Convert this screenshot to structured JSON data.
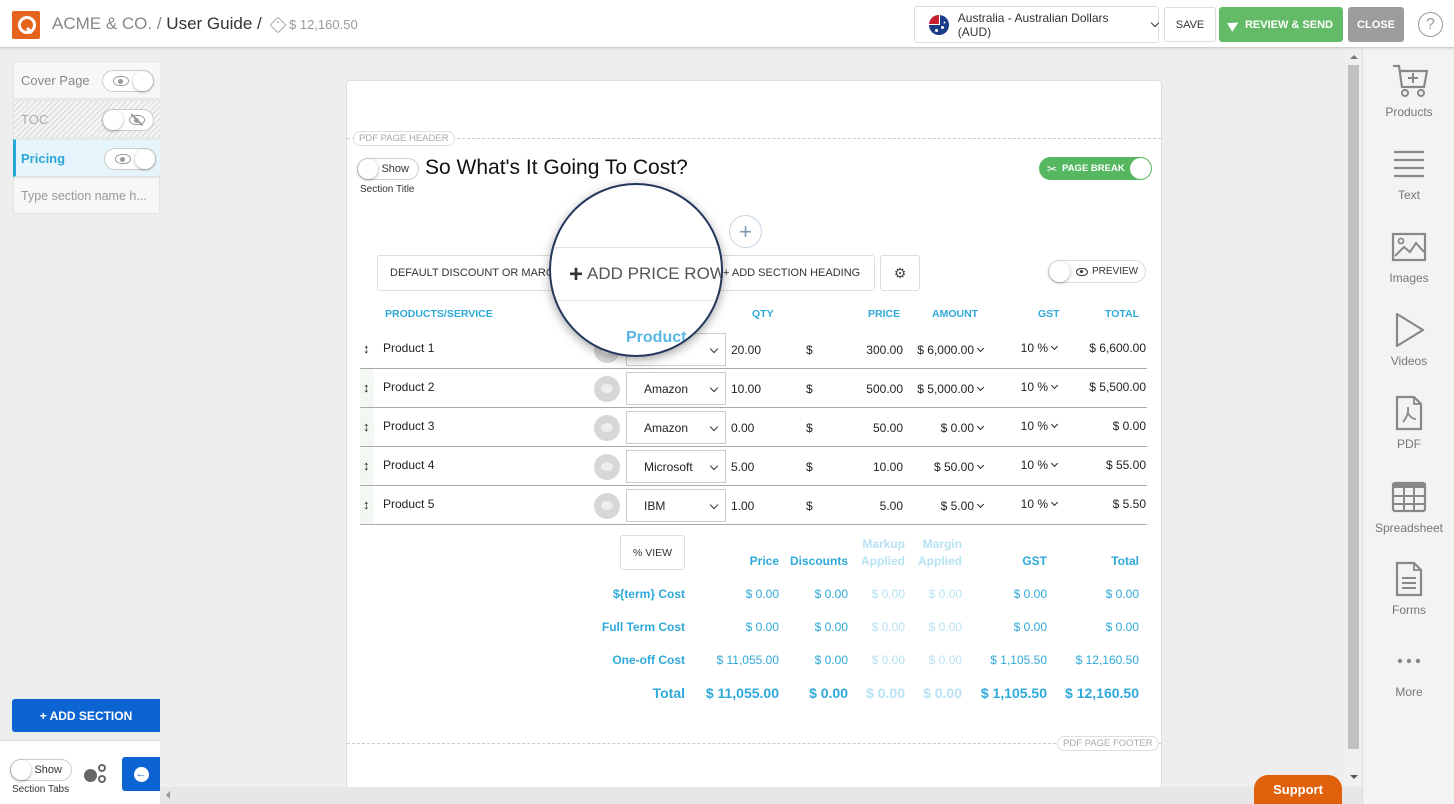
{
  "header": {
    "company": "ACME & CO. / ",
    "document": "User Guide /",
    "total": "$ 12,160.50",
    "currency": "Australia - Australian Dollars (AUD)",
    "save_label": "SAVE",
    "review_label": "REVIEW & SEND",
    "close_label": "CLOSE",
    "help_label": "?"
  },
  "sidebar": {
    "sections": [
      {
        "label": "Cover Page",
        "visible": true
      },
      {
        "label": "TOC",
        "visible": false
      },
      {
        "label": "Pricing",
        "visible": true,
        "active": true
      }
    ],
    "new_section_placeholder": "Type section name h...",
    "add_section_label": "+ ADD SECTION",
    "show_toggle_label": "Show",
    "section_tabs_caption": "Section Tabs"
  },
  "page": {
    "header_label": "PDF PAGE HEADER",
    "footer_label": "PDF PAGE FOOTER",
    "show_toggle_label": "Show",
    "section_title_caption": "Section Title",
    "title": "So What's It Going To Cost?",
    "page_break_label": "PAGE BREAK",
    "add_icon": "+",
    "toolbar": {
      "discount_label": "DEFAULT DISCOUNT OR MARGIN",
      "add_price_row_label": "ADD PRICE ROW",
      "add_section_heading_label": "+ ADD SECTION HEADING",
      "preview_label": "PREVIEW"
    },
    "magnifier": {
      "text": "ADD PRICE ROW",
      "plus": "+",
      "product_caption": "Product"
    },
    "columns": {
      "product": "PRODUCTS/SERVICE",
      "qty": "QTY",
      "price": "PRICE",
      "amount": "AMOUNT",
      "gst": "GST",
      "total": "TOTAL"
    },
    "rows": [
      {
        "name": "Product 1",
        "supplier": "",
        "qty": "20.00",
        "currency": "$",
        "price": "300.00",
        "amount": "$ 6,000.00",
        "gst": "10 %",
        "total": "$ 6,600.00"
      },
      {
        "name": "Product 2",
        "supplier": "Amazon",
        "qty": "10.00",
        "currency": "$",
        "price": "500.00",
        "amount": "$ 5,000.00",
        "gst": "10 %",
        "total": "$ 5,500.00"
      },
      {
        "name": "Product 3",
        "supplier": "Amazon",
        "qty": "0.00",
        "currency": "$",
        "price": "50.00",
        "amount": "$ 0.00",
        "gst": "10 %",
        "total": "$ 0.00"
      },
      {
        "name": "Product 4",
        "supplier": "Microsoft",
        "qty": "5.00",
        "currency": "$",
        "price": "10.00",
        "amount": "$ 50.00",
        "gst": "10 %",
        "total": "$ 55.00"
      },
      {
        "name": "Product 5",
        "supplier": "IBM",
        "qty": "1.00",
        "currency": "$",
        "price": "5.00",
        "amount": "$ 5.00",
        "gst": "10 %",
        "total": "$ 5.50"
      }
    ],
    "pct_view_label": "% VIEW",
    "summary": {
      "headers": {
        "price": "Price",
        "discounts": "Discounts",
        "markup_1": "Markup",
        "markup_2": "Applied",
        "margin_1": "Margin",
        "margin_2": "Applied",
        "gst": "GST",
        "total": "Total"
      },
      "rows": [
        {
          "label": "${term} Cost",
          "price": "$ 0.00",
          "discounts": "$ 0.00",
          "markup": "$ 0.00",
          "margin": "$ 0.00",
          "gst": "$ 0.00",
          "total": "$ 0.00"
        },
        {
          "label": "Full Term Cost",
          "price": "$ 0.00",
          "discounts": "$ 0.00",
          "markup": "$ 0.00",
          "margin": "$ 0.00",
          "gst": "$ 0.00",
          "total": "$ 0.00"
        },
        {
          "label": "One-off Cost",
          "price": "$ 11,055.00",
          "discounts": "$ 0.00",
          "markup": "$ 0.00",
          "margin": "$ 0.00",
          "gst": "$ 1,105.50",
          "total": "$ 12,160.50"
        },
        {
          "label": "Total",
          "price": "$ 11,055.00",
          "discounts": "$ 0.00",
          "markup": "$ 0.00",
          "margin": "$ 0.00",
          "gst": "$ 1,105.50",
          "total": "$ 12,160.50"
        }
      ]
    }
  },
  "tools": [
    {
      "label": "Products",
      "icon": "cart-icon"
    },
    {
      "label": "Text",
      "icon": "text-icon"
    },
    {
      "label": "Images",
      "icon": "image-icon"
    },
    {
      "label": "Videos",
      "icon": "play-icon"
    },
    {
      "label": "PDF",
      "icon": "pdf-icon"
    },
    {
      "label": "Spreadsheet",
      "icon": "spreadsheet-icon"
    },
    {
      "label": "Forms",
      "icon": "form-icon"
    },
    {
      "label": "More",
      "icon": "more-icon"
    }
  ],
  "support_label": "Support",
  "colors": {
    "brand": "#e5631c",
    "accent": "#2ea9d9",
    "review": "#64bb67",
    "add_section": "#0c64d2",
    "support": "#e0600b"
  }
}
